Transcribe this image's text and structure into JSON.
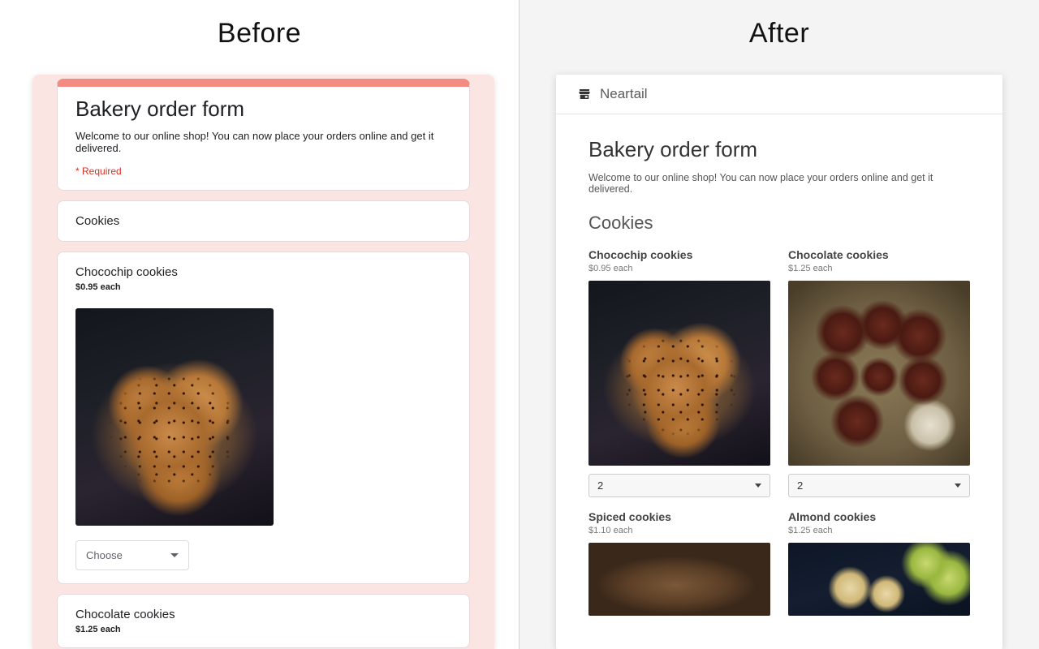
{
  "comparison": {
    "before_label": "Before",
    "after_label": "After"
  },
  "before": {
    "form_title": "Bakery order form",
    "form_description": "Welcome to our online shop! You can now place your orders online and get it delivered.",
    "required_label": "* Required",
    "section_title": "Cookies",
    "dropdown_placeholder": "Choose",
    "items": [
      {
        "name": "Chocochip cookies",
        "price": "$0.95 each"
      },
      {
        "name": "Chocolate cookies",
        "price": "$1.25 each"
      }
    ]
  },
  "after": {
    "brand": "Neartail",
    "form_title": "Bakery order form",
    "form_description": "Welcome to our online shop! You can now place your orders online and get it delivered.",
    "section_title": "Cookies",
    "items": [
      {
        "name": "Chocochip cookies",
        "price": "$0.95 each",
        "qty": "2"
      },
      {
        "name": "Chocolate cookies",
        "price": "$1.25 each",
        "qty": "2"
      },
      {
        "name": "Spiced cookies",
        "price": "$1.10 each"
      },
      {
        "name": "Almond cookies",
        "price": "$1.25 each"
      }
    ]
  }
}
